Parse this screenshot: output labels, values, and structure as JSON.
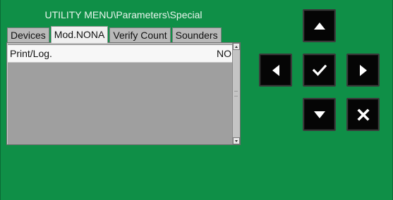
{
  "header": {
    "title": "UTILITY MENU\\Parameters\\Special"
  },
  "tabs": [
    {
      "label": "Devices",
      "active": false
    },
    {
      "label": "Mod.NONA",
      "active": true
    },
    {
      "label": "Verify Count",
      "active": false
    },
    {
      "label": "Sounders",
      "active": false
    }
  ],
  "list": {
    "rows": [
      {
        "label": "Print/Log.",
        "value": "NO"
      }
    ]
  },
  "keypad": {
    "up": "arrow-up-icon",
    "left": "arrow-left-icon",
    "ok": "check-icon",
    "right": "arrow-right-icon",
    "down": "arrow-down-icon",
    "cancel": "cross-icon"
  },
  "colors": {
    "background": "#0f8f47",
    "panel": "#9f9f9f",
    "tab": "#b9b9b9",
    "active_tab": "#f0f0f0",
    "button": "#050505"
  }
}
